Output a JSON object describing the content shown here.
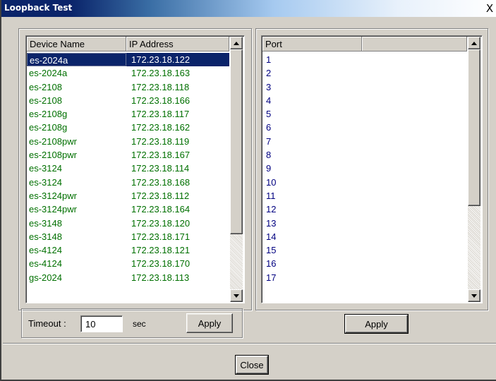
{
  "window": {
    "title": "Loopback Test",
    "close_glyph": "X"
  },
  "device_table": {
    "columns": [
      "Device Name",
      "IP Address"
    ],
    "rows": [
      {
        "name": "es-2024a",
        "ip": "172.23.18.122",
        "selected": true
      },
      {
        "name": "es-2024a",
        "ip": "172.23.18.163"
      },
      {
        "name": "es-2108",
        "ip": "172.23.18.118"
      },
      {
        "name": "es-2108",
        "ip": "172.23.18.166"
      },
      {
        "name": "es-2108g",
        "ip": "172.23.18.117"
      },
      {
        "name": "es-2108g",
        "ip": "172.23.18.162"
      },
      {
        "name": "es-2108pwr",
        "ip": "172.23.18.119"
      },
      {
        "name": "es-2108pwr",
        "ip": "172.23.18.167"
      },
      {
        "name": "es-3124",
        "ip": "172.23.18.114"
      },
      {
        "name": "es-3124",
        "ip": "172.23.18.168"
      },
      {
        "name": "es-3124pwr",
        "ip": "172.23.18.112"
      },
      {
        "name": "es-3124pwr",
        "ip": "172.23.18.164"
      },
      {
        "name": "es-3148",
        "ip": "172.23.18.120"
      },
      {
        "name": "es-3148",
        "ip": "172.23.18.171"
      },
      {
        "name": "es-4124",
        "ip": "172.23.18.121"
      },
      {
        "name": "es-4124",
        "ip": "172.23.18.170"
      },
      {
        "name": "gs-2024",
        "ip": "172.23.18.113"
      }
    ]
  },
  "port_table": {
    "columns": [
      "Port",
      ""
    ],
    "rows": [
      "1",
      "2",
      "3",
      "4",
      "5",
      "6",
      "7",
      "8",
      "9",
      "10",
      "11",
      "12",
      "13",
      "14",
      "15",
      "16",
      "17"
    ]
  },
  "timeout": {
    "label": "Timeout :",
    "value": "10",
    "unit": "sec",
    "apply_label": "Apply"
  },
  "port_apply_label": "Apply",
  "close_label": "Close",
  "colors": {
    "title_bar": "#0a246a",
    "device_text": "#007000",
    "port_text": "#000080",
    "selection": "#0a246a"
  }
}
